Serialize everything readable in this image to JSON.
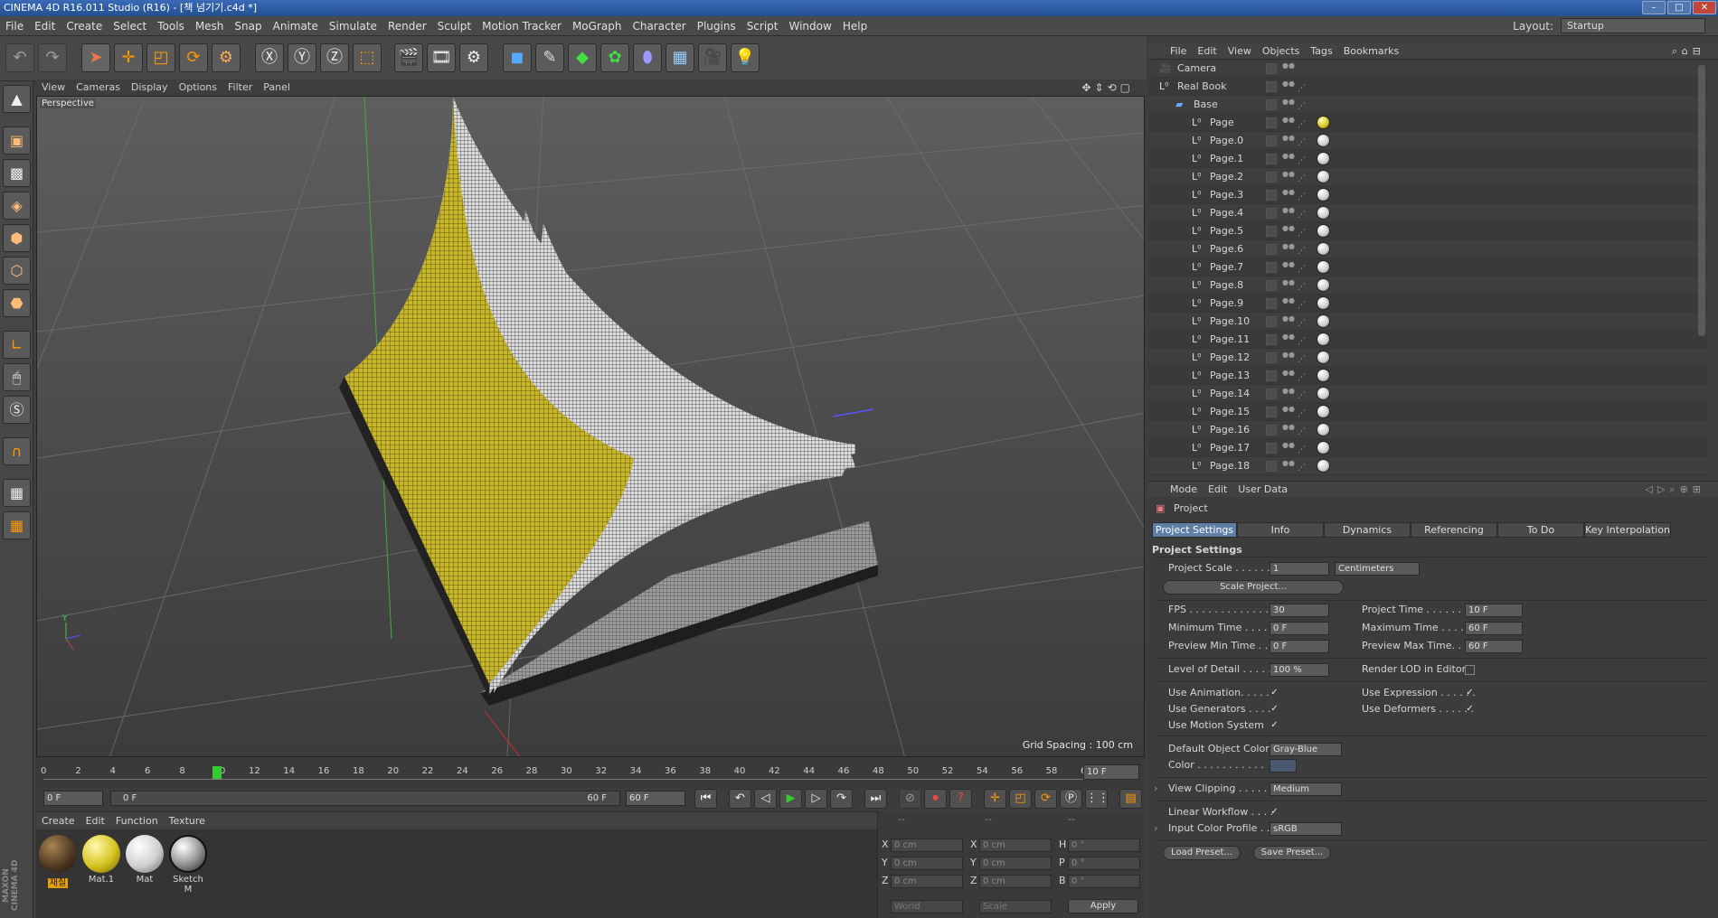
{
  "window": {
    "title": "CINEMA 4D R16.011 Studio (R16) - [책 넘기기.c4d *]"
  },
  "menu": [
    "File",
    "Edit",
    "Create",
    "Select",
    "Tools",
    "Mesh",
    "Snap",
    "Animate",
    "Simulate",
    "Render",
    "Sculpt",
    "Motion Tracker",
    "MoGraph",
    "Character",
    "Plugins",
    "Script",
    "Window",
    "Help"
  ],
  "layout": {
    "label": "Layout:",
    "value": "Startup"
  },
  "viewport": {
    "menu": [
      "View",
      "Cameras",
      "Display",
      "Options",
      "Filter",
      "Panel"
    ],
    "label": "Perspective",
    "grid_spacing": "Grid Spacing : 100 cm"
  },
  "timeline": {
    "ticks": [
      "0",
      "2",
      "4",
      "6",
      "8",
      "10",
      "12",
      "14",
      "16",
      "18",
      "20",
      "22",
      "24",
      "26",
      "28",
      "30",
      "32",
      "34",
      "36",
      "38",
      "40",
      "42",
      "44",
      "46",
      "48",
      "50",
      "52",
      "54",
      "56",
      "58",
      "60"
    ],
    "current_frame": 10,
    "end_field": "10 F",
    "start_field": "0 F",
    "range_start": "0 F",
    "range_end": "60 F",
    "max_field": "60 F"
  },
  "material_menu": [
    "Create",
    "Edit",
    "Function",
    "Texture"
  ],
  "materials": [
    {
      "name": "재질",
      "color": "#4a3520"
    },
    {
      "name": "Mat.1",
      "color": "#d6c21e"
    },
    {
      "name": "Mat",
      "color": "#e8e8e8"
    },
    {
      "name": "Sketch M",
      "color": "#bfbfbf"
    }
  ],
  "coords": {
    "headers": [
      "--",
      "--",
      "--"
    ],
    "rows": [
      {
        "a": "X",
        "av": "0 cm",
        "b": "X",
        "bv": "0 cm",
        "c": "H",
        "cv": "0 °"
      },
      {
        "a": "Y",
        "av": "0 cm",
        "b": "Y",
        "bv": "0 cm",
        "c": "P",
        "cv": "0 °"
      },
      {
        "a": "Z",
        "av": "0 cm",
        "b": "Z",
        "bv": "0 cm",
        "c": "B",
        "cv": "0 °"
      }
    ],
    "world": "World",
    "scale": "Scale",
    "apply": "Apply"
  },
  "object_menu": [
    "File",
    "Edit",
    "View",
    "Objects",
    "Tags",
    "Bookmarks"
  ],
  "objects": [
    {
      "name": "Camera",
      "indent": 0
    },
    {
      "name": "Real Book",
      "indent": 0
    },
    {
      "name": "Base",
      "indent": 1
    },
    {
      "name": "Page",
      "indent": 2
    },
    {
      "name": "Page.0",
      "indent": 2
    },
    {
      "name": "Page.1",
      "indent": 2
    },
    {
      "name": "Page.2",
      "indent": 2
    },
    {
      "name": "Page.3",
      "indent": 2
    },
    {
      "name": "Page.4",
      "indent": 2
    },
    {
      "name": "Page.5",
      "indent": 2
    },
    {
      "name": "Page.6",
      "indent": 2
    },
    {
      "name": "Page.7",
      "indent": 2
    },
    {
      "name": "Page.8",
      "indent": 2
    },
    {
      "name": "Page.9",
      "indent": 2
    },
    {
      "name": "Page.10",
      "indent": 2
    },
    {
      "name": "Page.11",
      "indent": 2
    },
    {
      "name": "Page.12",
      "indent": 2
    },
    {
      "name": "Page.13",
      "indent": 2
    },
    {
      "name": "Page.14",
      "indent": 2
    },
    {
      "name": "Page.15",
      "indent": 2
    },
    {
      "name": "Page.16",
      "indent": 2
    },
    {
      "name": "Page.17",
      "indent": 2
    },
    {
      "name": "Page.18",
      "indent": 2
    }
  ],
  "attr_menu": [
    "Mode",
    "Edit",
    "User Data"
  ],
  "attributes": {
    "object": "Project",
    "tabs": [
      "Project Settings",
      "Info",
      "Dynamics",
      "Referencing",
      "To Do",
      "Key Interpolation"
    ],
    "section": "Project Settings",
    "project_scale_label": "Project Scale . . . . . .",
    "project_scale": "1",
    "units": "Centimeters",
    "scale_project": "Scale Project...",
    "fps_label": "FPS . . . . . . . . . . . . . .",
    "fps": "30",
    "project_time_label": "Project Time . . . . . . . .",
    "project_time": "10 F",
    "min_time_label": "Minimum Time . . . .",
    "min_time": "0 F",
    "max_time_label": "Maximum Time . . . . .",
    "max_time": "60 F",
    "prev_min_label": "Preview Min Time . .",
    "prev_min": "0 F",
    "prev_max_label": "Preview Max Time. . .",
    "prev_max": "60 F",
    "lod_label": "Level of Detail . . . . .",
    "lod": "100 %",
    "render_lod": "Render LOD in Editor",
    "use_animation": "Use Animation. . . . .",
    "use_expression": "Use Expression . . . . . .",
    "use_generators": "Use Generators . . . .",
    "use_deformers": "Use Deformers . . . . . .",
    "use_motion": "Use Motion System",
    "default_color_label": "Default Object Color",
    "default_color": "Gray-Blue",
    "color_label": "Color . . . . . . . . . . .",
    "view_clipping_label": "View Clipping . . . . . .",
    "view_clipping": "Medium",
    "linear_workflow": "Linear Workflow . . . .",
    "input_profile_label": "Input Color Profile . . .",
    "input_profile": "sRGB",
    "load_preset": "Load Preset...",
    "save_preset": "Save Preset..."
  }
}
